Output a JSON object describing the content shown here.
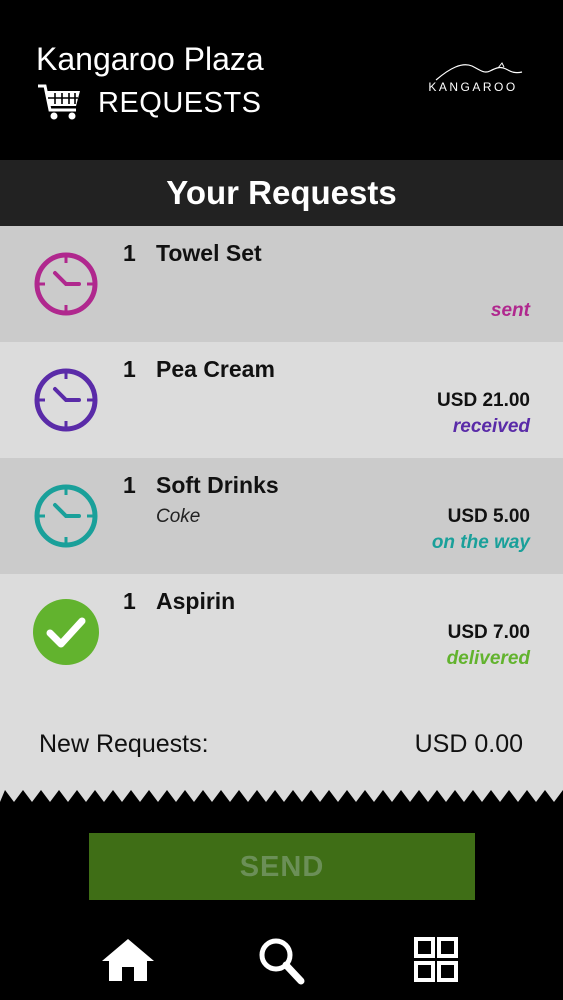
{
  "header": {
    "hotel_name": "Kangaroo Plaza",
    "section": "REQUESTS",
    "logo_text": "KANGAROO"
  },
  "page_title": "Your Requests",
  "requests": [
    {
      "qty": "1",
      "name": "Towel Set",
      "note": "",
      "price": "",
      "status": "sent",
      "status_color": "#b0288e",
      "icon": "clock-icon"
    },
    {
      "qty": "1",
      "name": "Pea Cream",
      "note": "",
      "price": "USD 21.00",
      "status": "received",
      "status_color": "#5a2ba8",
      "icon": "clock-icon"
    },
    {
      "qty": "1",
      "name": "Soft Drinks",
      "note": "Coke",
      "price": "USD 5.00",
      "status": "on the way",
      "status_color": "#1aa09a",
      "icon": "clock-icon"
    },
    {
      "qty": "1",
      "name": "Aspirin",
      "note": "",
      "price": "USD 7.00",
      "status": "delivered",
      "status_color": "#62b32e",
      "icon": "checkmark-icon"
    }
  ],
  "summary": {
    "label": "New Requests:",
    "value": "USD 0.00"
  },
  "send_button": {
    "label": "SEND"
  },
  "bottom_nav": [
    "home-icon",
    "search-icon",
    "grid-icon"
  ],
  "colors": {
    "header_bg": "#000000",
    "title_bar_bg": "#222222",
    "row_dark": "#cbcbcb",
    "row_light": "#dcdcdc",
    "send_bg": "#3f6e16"
  }
}
